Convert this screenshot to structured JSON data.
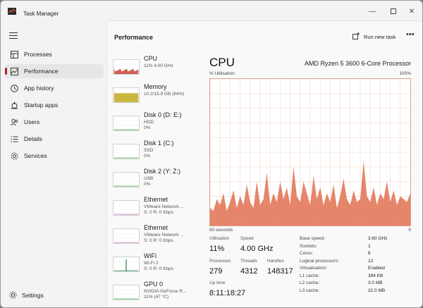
{
  "window": {
    "title": "Task Manager",
    "controls": [
      "minimize-icon",
      "maximize-icon",
      "close-icon"
    ]
  },
  "sidebar": {
    "items": [
      {
        "label": "Processes",
        "icon": "processes-icon"
      },
      {
        "label": "Performance",
        "icon": "performance-icon",
        "active": true
      },
      {
        "label": "App history",
        "icon": "history-icon"
      },
      {
        "label": "Startup apps",
        "icon": "startup-icon"
      },
      {
        "label": "Users",
        "icon": "users-icon"
      },
      {
        "label": "Details",
        "icon": "details-icon"
      },
      {
        "label": "Services",
        "icon": "services-icon"
      }
    ],
    "settings_label": "Settings"
  },
  "header": {
    "title": "Performance",
    "run_new_task": "Run new task",
    "more": "•••"
  },
  "perf_list": [
    {
      "name": "CPU",
      "lines": [
        "11%  4.00 GHz"
      ],
      "color": "#c0392b"
    },
    {
      "name": "Memory",
      "lines": [
        "10.2/15.9 GB (64%)"
      ],
      "color": "#b8a000"
    },
    {
      "name": "Disk 0 (D: E:)",
      "lines": [
        "HDD",
        "0%"
      ],
      "color": "#4caf50"
    },
    {
      "name": "Disk 1 (C:)",
      "lines": [
        "SSD",
        "0%"
      ],
      "color": "#4caf50"
    },
    {
      "name": "Disk 2 (Y: Z:)",
      "lines": [
        "USB",
        "0%"
      ],
      "color": "#4caf50"
    },
    {
      "name": "Ethernet",
      "lines": [
        "VMware Network ...",
        "S: 0  R: 0 Kbps"
      ],
      "color": "#c77dbb"
    },
    {
      "name": "Ethernet",
      "lines": [
        "VMware Network ...",
        "S: 0  R: 0 Kbps"
      ],
      "color": "#c77dbb"
    },
    {
      "name": "WiFi",
      "lines": [
        "Wi-Fi 2",
        "S: 0  R: 0 Kbps"
      ],
      "color": "#2e8b57"
    },
    {
      "name": "GPU 0",
      "lines": [
        "NVIDIA GeForce R...",
        "11% (47 °C)"
      ],
      "color": "#4caf50"
    }
  ],
  "detail": {
    "title": "CPU",
    "processor": "AMD Ryzen 5 3600 6-Core Processor",
    "util_label": "% Utilisation",
    "util_max": "100%",
    "graph_left": "60 seconds",
    "graph_right": "0",
    "graph_color": "#e07050",
    "graph_values": [
      12,
      10,
      18,
      14,
      22,
      10,
      16,
      24,
      12,
      20,
      14,
      28,
      16,
      12,
      30,
      14,
      18,
      36,
      14,
      22,
      16,
      30,
      18,
      26,
      14,
      40,
      20,
      16,
      30,
      22,
      14,
      34,
      18,
      26,
      14,
      22,
      16,
      28,
      12,
      20,
      32,
      18,
      14,
      24,
      16,
      18,
      44,
      20,
      16,
      26,
      14,
      22,
      18,
      30,
      16,
      24,
      14,
      20,
      18,
      16,
      22
    ],
    "stats": {
      "utilisation": {
        "label": "Utilisation",
        "value": "11%"
      },
      "speed": {
        "label": "Speed",
        "value": "4.00 GHz"
      },
      "processes": {
        "label": "Processes",
        "value": "279"
      },
      "threads": {
        "label": "Threads",
        "value": "4312"
      },
      "handles": {
        "label": "Handles",
        "value": "148317"
      },
      "uptime": {
        "label": "Up time",
        "value": "8:11:18:27"
      }
    },
    "specs": [
      {
        "k": "Base speed:",
        "v": "3.60 GHz"
      },
      {
        "k": "Sockets:",
        "v": "1"
      },
      {
        "k": "Cores:",
        "v": "6"
      },
      {
        "k": "Logical processors:",
        "v": "12"
      },
      {
        "k": "Virtualisation:",
        "v": "Enabled"
      },
      {
        "k": "L1 cache:",
        "v": "384 KB"
      },
      {
        "k": "L2 cache:",
        "v": "3.0 MB"
      },
      {
        "k": "L3 cache:",
        "v": "32.0 MB"
      }
    ]
  }
}
